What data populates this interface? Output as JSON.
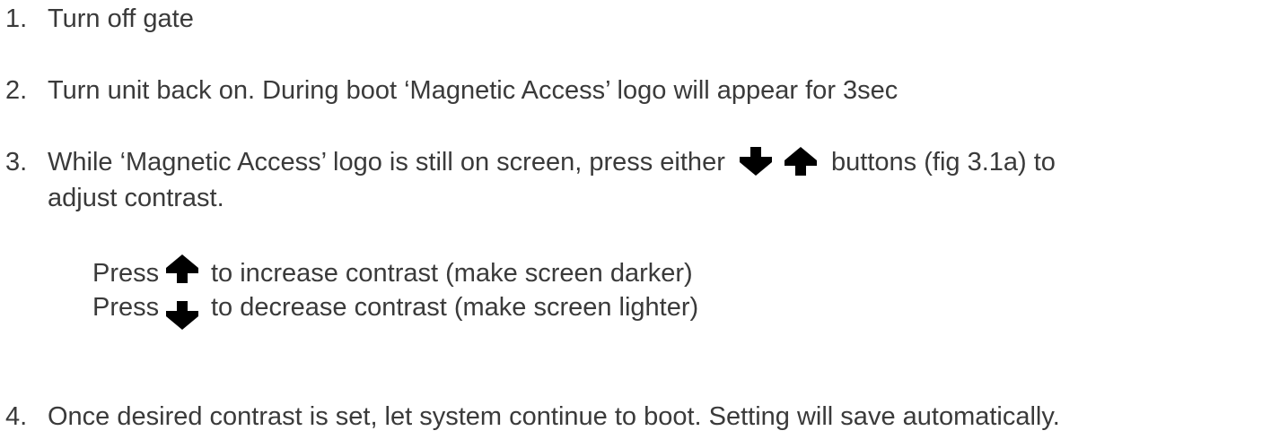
{
  "steps": [
    {
      "number": "1.",
      "text": "Turn off gate"
    },
    {
      "number": "2.",
      "text": "Turn unit back on. During boot ‘Magnetic Access’ logo will appear for 3sec"
    },
    {
      "number": "3.",
      "text_before_icons": "While ‘Magnetic Access’ logo is still on screen, press either",
      "text_after_icons": "buttons (fig 3.1a) to",
      "continuation": "adjust contrast.",
      "sub_items": [
        {
          "label": "Press",
          "icon": "arrow-up-icon",
          "text": "to increase contrast (make screen darker)"
        },
        {
          "label": "Press",
          "icon": "arrow-down-icon",
          "text": "to decrease contrast (make screen lighter)"
        }
      ]
    },
    {
      "number": "4.",
      "text": "Once desired contrast is set, let system continue to boot. Setting will save automatically."
    }
  ],
  "icons": {
    "down": "arrow-down-icon",
    "up": "arrow-up-icon",
    "color": "#000000"
  },
  "colors": {
    "text": "#3a3a3a",
    "background": "#ffffff"
  }
}
